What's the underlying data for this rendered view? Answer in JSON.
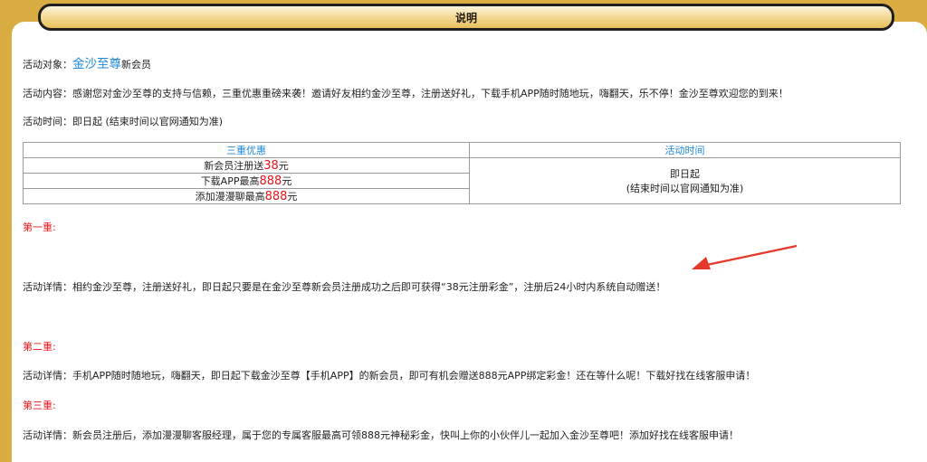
{
  "header": {
    "title": "说明"
  },
  "target": {
    "label": "活动对象：",
    "brand": "金沙至尊",
    "suffix": "新会员"
  },
  "content_line": {
    "label": "活动内容：",
    "text": "感谢您对金沙至尊的支持与信赖，三重优惠重磅来袭！邀请好友相约金沙至尊，注册送好礼，下载手机APP随时随地玩，嗨翻天，乐不停！金沙至尊欢迎您的到来！"
  },
  "time_line": {
    "label": "活动时间：",
    "text": "即日起 (结束时间以官网通知为准)"
  },
  "table": {
    "col1_header": "三重优惠",
    "col2_header": "活动时间",
    "rows": [
      {
        "prefix": "新会员注册送",
        "amount": "38",
        "unit": "元"
      },
      {
        "prefix": "下载APP最高",
        "amount": "888",
        "unit": "元"
      },
      {
        "prefix": "添加漫漫聊最高",
        "amount": "888",
        "unit": "元"
      }
    ],
    "time_line1": "即日起",
    "time_line2": "(结束时间以官网通知为准)"
  },
  "section1": {
    "title": "第一重:",
    "detail": "活动详情：相约金沙至尊，注册送好礼，即日起只要是在金沙至尊新会员注册成功之后即可获得“38元注册彩金”，注册后24小时内系统自动赠送！"
  },
  "section2": {
    "title": "第二重:",
    "detail": "活动详情：手机APP随时随地玩，嗨翻天，即日起下载金沙至尊【手机APP】的新会员，即可有机会赠送888元APP绑定彩金！还在等什么呢！下载好找在线客服申请！"
  },
  "section3": {
    "title": "第三重:",
    "detail": "活动详情：新会员注册后，添加漫漫聊客服经理，属于您的专属客服最高可领888元神秘彩金，快叫上你的小伙伴儿一起加入金沙至尊吧！添加好找在线客服申请！"
  },
  "colors": {
    "background": "#d9ad41",
    "link_blue": "#1e88d9",
    "accent_red": "#e8141a",
    "arrow_red": "#e53a2b"
  }
}
